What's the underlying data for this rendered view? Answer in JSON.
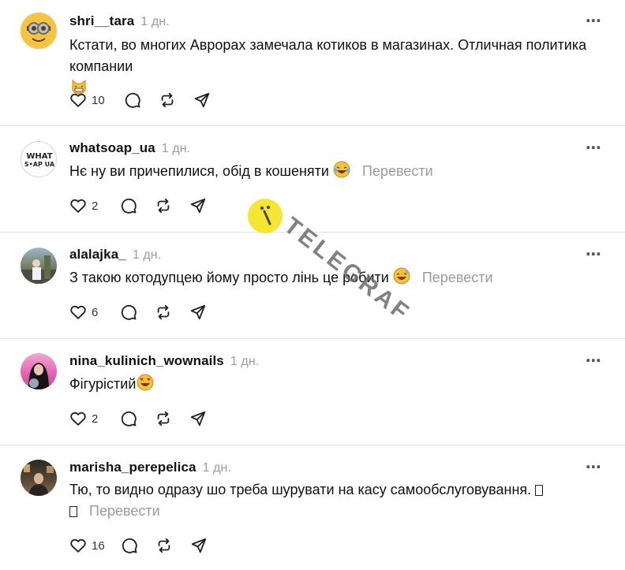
{
  "comments": [
    {
      "username": "shri__tara",
      "time": "1 дн.",
      "text": "Кстати, во многих Аврорах замечала котиков в магазинах. Отличная политика компании",
      "translate": "",
      "likes": "10"
    },
    {
      "username": "whatsoap_ua",
      "time": "1 дн.",
      "text": "Нє ну ви причепилися, обід в кошеняти",
      "translate": "Перевести",
      "likes": "2",
      "avatar_text": "WHAT SOAP UA"
    },
    {
      "username": "alalajka_",
      "time": "1 дн.",
      "text": "З такою котодупцею йому просто лінь це робити",
      "translate": "Перевести",
      "likes": "6"
    },
    {
      "username": "nina_kulinich_wownails",
      "time": "1 дн.",
      "text": "Фігурістий",
      "translate": "",
      "likes": "2"
    },
    {
      "username": "marisha_perepelica",
      "time": "1 дн.",
      "text": "Тю, то видно одразу шо треба шурувати на касу самообслуговування.",
      "translate": "Перевести",
      "likes": "16"
    }
  ],
  "more_icon": "⋯",
  "watermark": {
    "text": "TELEGRAF",
    "logo_color": "#f5e634"
  }
}
